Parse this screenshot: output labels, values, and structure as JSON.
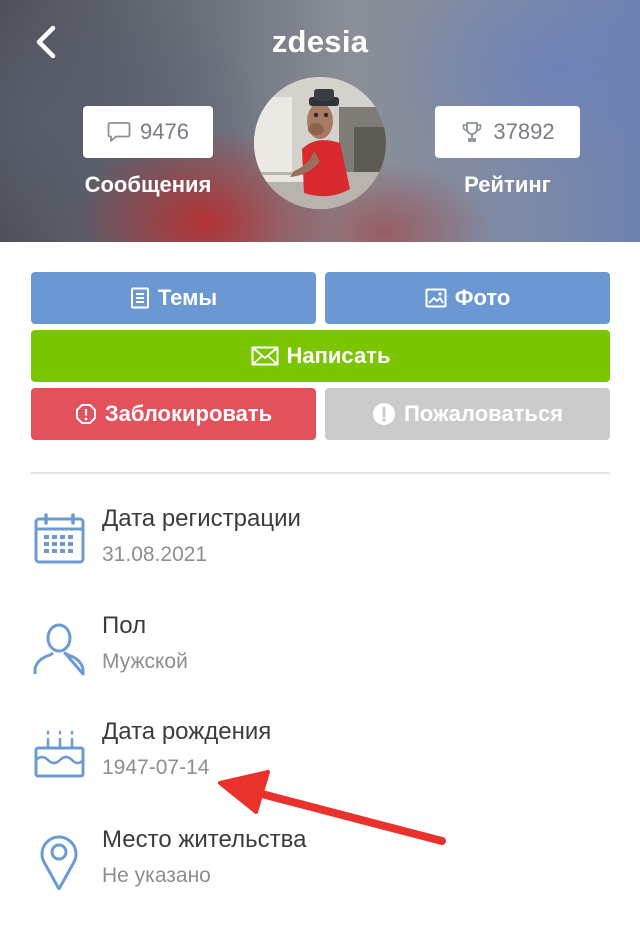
{
  "header": {
    "title": "zdesia",
    "messages": {
      "count": "9476",
      "label": "Сообщения",
      "icon": "speech-bubble-icon"
    },
    "rating": {
      "count": "37892",
      "label": "Рейтинг",
      "icon": "trophy-icon"
    }
  },
  "actions": {
    "topics": "Темы",
    "photo": "Фото",
    "write": "Написать",
    "block": "Заблокировать",
    "report": "Пожаловаться"
  },
  "info": [
    {
      "title": "Дата регистрации",
      "value": "31.08.2021",
      "icon": "calendar-icon"
    },
    {
      "title": "Пол",
      "value": "Мужской",
      "icon": "user-icon"
    },
    {
      "title": "Дата рождения",
      "value": "1947-07-14",
      "icon": "birthday-cake-icon"
    },
    {
      "title": "Место жительства",
      "value": "Не указано",
      "icon": "location-pin-icon"
    }
  ],
  "colors": {
    "blue": "#6b98d3",
    "green": "#7bc502",
    "red": "#e3525c",
    "grey": "#cbcbcb",
    "icon": "#6c9bd2",
    "annotation_arrow": "#e8322b"
  }
}
